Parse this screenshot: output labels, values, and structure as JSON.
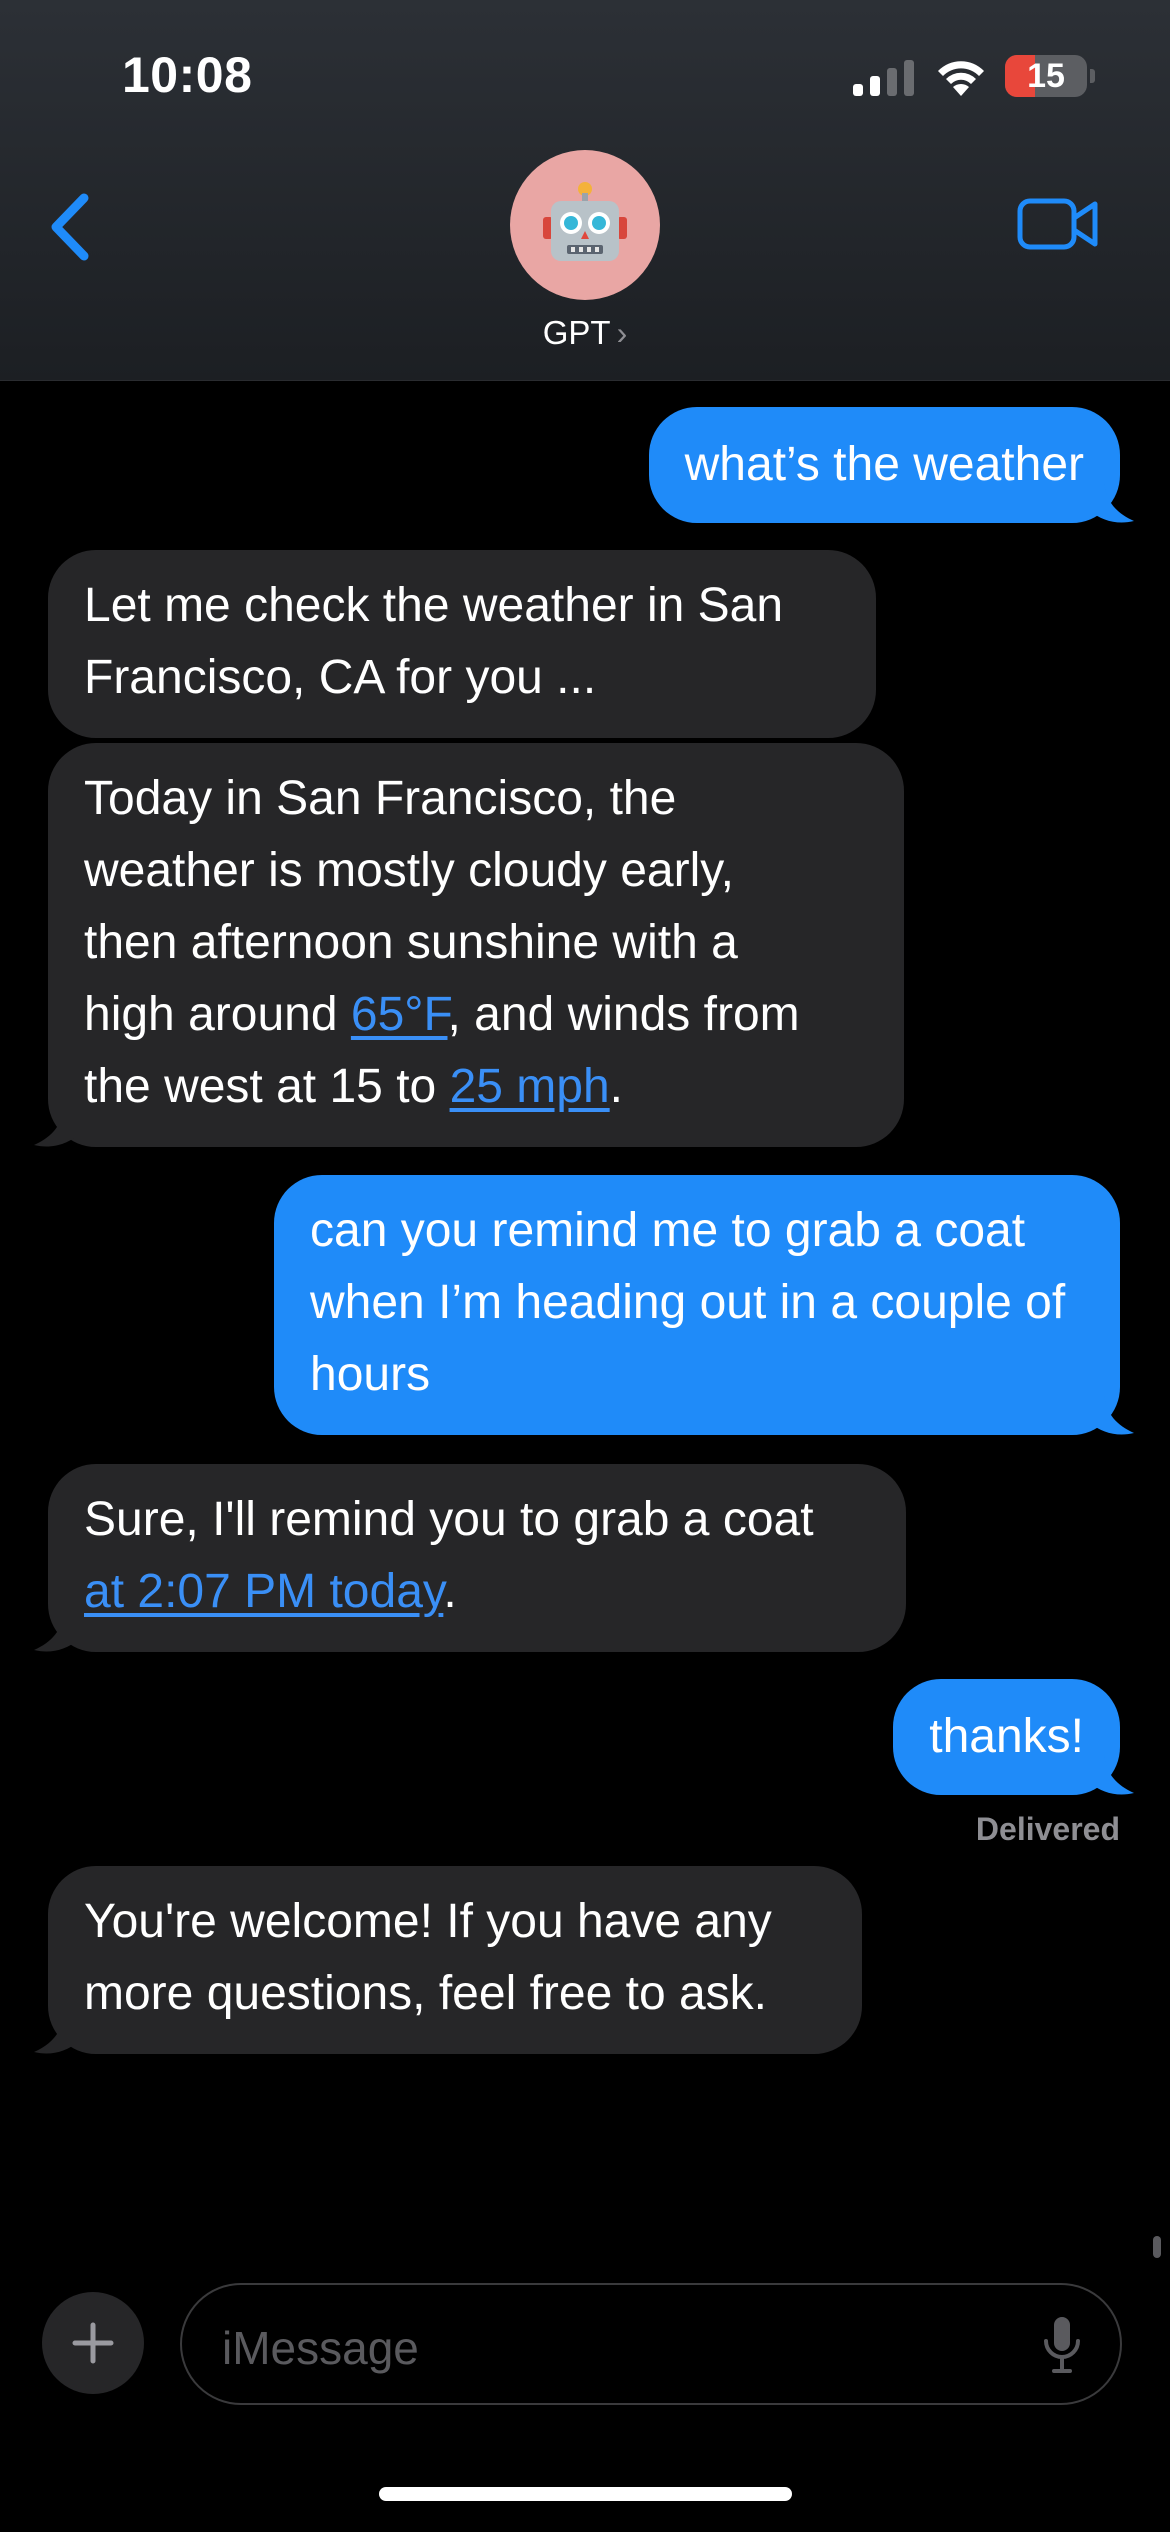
{
  "status_bar": {
    "time": "10:08",
    "battery": "15"
  },
  "header": {
    "contact_name": "GPT",
    "chevron": "›",
    "avatar_emoji": "🤖"
  },
  "messages": [
    {
      "from": "me",
      "text": "what’s the weather"
    },
    {
      "from": "them",
      "text": "Let me check the weather in San Francisco, CA for you ..."
    },
    {
      "from": "them",
      "line1": "Today in San Francisco, the",
      "line2": "weather is mostly cloudy early,",
      "line3": "then afternoon sunshine with a",
      "line4_pre": "high around ",
      "link_temp": "65°F",
      "line4_post": ", and winds from",
      "line5_pre": "the west at 15 to ",
      "link_wind": "25 mph",
      "line5_post": "."
    },
    {
      "from": "me",
      "text": "can you remind me to grab a coat when I’m heading out in a couple of hours"
    },
    {
      "from": "them",
      "line1": "Sure, I'll remind you to grab a coat",
      "link_time": "at 2:07 PM today",
      "line2_post": "."
    },
    {
      "from": "me",
      "text": "thanks!"
    },
    {
      "from": "them",
      "text": "You're welcome! If you have any more questions, feel free to ask."
    }
  ],
  "delivered_label": "Delivered",
  "composer": {
    "placeholder": "iMessage"
  },
  "colors": {
    "outgoing": "#1f8bf9",
    "incoming": "#262628",
    "link": "#3a8ff6",
    "accent": "#1f8bf9"
  },
  "icons": [
    "back-chevron-icon",
    "video-camera-icon",
    "plus-icon",
    "microphone-icon",
    "cellular-signal-icon",
    "wifi-icon",
    "battery-icon"
  ]
}
